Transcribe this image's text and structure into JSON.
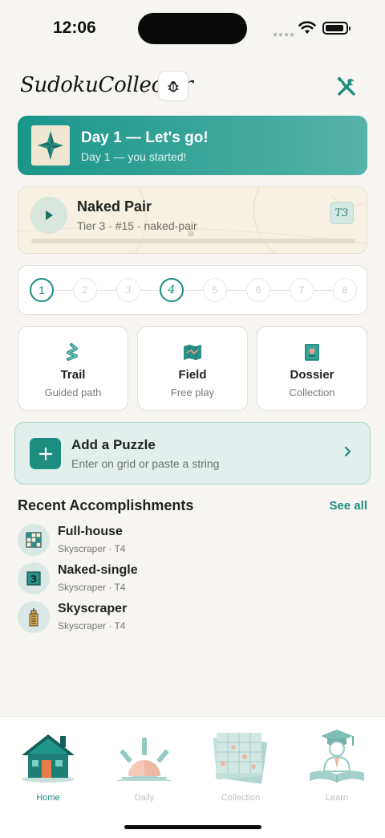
{
  "status_bar": {
    "time": "12:06"
  },
  "header": {
    "title": "SudokuCollector"
  },
  "streak": {
    "title": "Day 1 — Let's go!",
    "subtitle": "Day 1 — you started!"
  },
  "current_puzzle": {
    "name": "Naked Pair",
    "meta": "Tier 3 · #15 · naked-pair",
    "tier_badge": "T3",
    "progress": 0
  },
  "stepper": {
    "steps": [
      "1",
      "2",
      "3",
      "4",
      "5",
      "6",
      "7",
      "8"
    ],
    "active": [
      "1",
      "4"
    ]
  },
  "modes": [
    {
      "title": "Trail",
      "subtitle": "Guided path",
      "icon": "trail-icon"
    },
    {
      "title": "Field",
      "subtitle": "Free play",
      "icon": "field-icon"
    },
    {
      "title": "Dossier",
      "subtitle": "Collection",
      "icon": "dossier-icon"
    }
  ],
  "add_puzzle": {
    "title": "Add a Puzzle",
    "subtitle": "Enter on grid or paste a string"
  },
  "accomplishments": {
    "title": "Recent Accomplishments",
    "see_all": "See all",
    "items": [
      {
        "title": "Full-house",
        "subtitle": "Skyscraper · T4",
        "icon": "grid-icon"
      },
      {
        "title": "Naked-single",
        "subtitle": "Skyscraper · T4",
        "icon": "number-three-icon",
        "badge": "3"
      },
      {
        "title": "Skyscraper",
        "subtitle": "Skyscraper · T4",
        "icon": "skyscraper-icon"
      }
    ]
  },
  "tabs": [
    {
      "label": "Home",
      "active": true
    },
    {
      "label": "Daily",
      "active": false
    },
    {
      "label": "Collection",
      "active": false
    },
    {
      "label": "Learn",
      "active": false
    }
  ],
  "colors": {
    "accent": "#1d8c81",
    "background": "#f7f5f1",
    "banner_start": "#1a958a",
    "banner_end": "#56b3a9"
  }
}
